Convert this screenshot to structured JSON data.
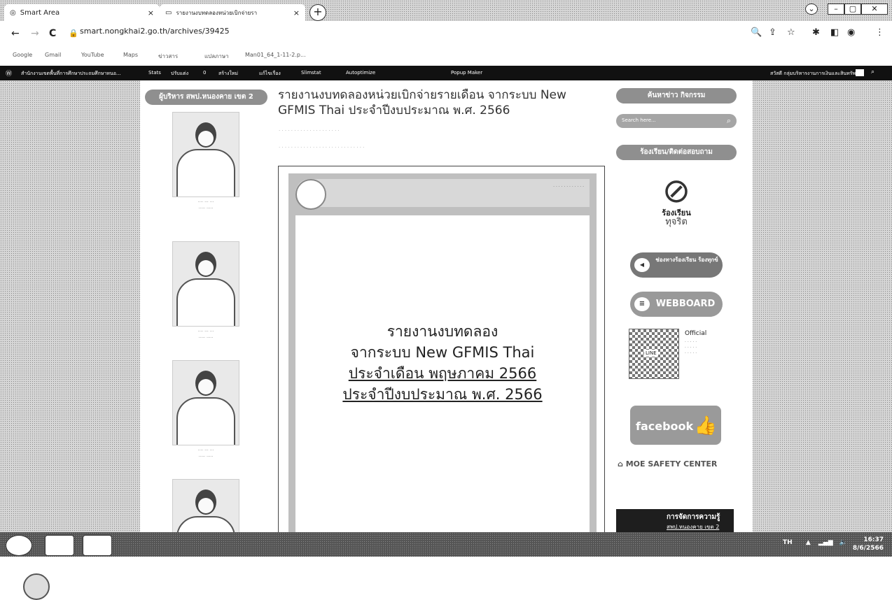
{
  "browser": {
    "tabs": [
      {
        "label": "Smart Area",
        "close": "×"
      },
      {
        "label": "รายงานงบทดลองหน่วยเบิกจ่ายรา",
        "close": "×"
      }
    ],
    "new_tab": "+",
    "url": "smart.nongkhai2.go.th/archives/39425",
    "nav": {
      "back": "←",
      "forward": "→",
      "reload": "C"
    },
    "bookmarks": [
      "Google",
      "Gmail",
      "YouTube",
      "Maps",
      "ข่าวสาร",
      "แปลภาษา",
      "Man01_64_1-11-2.p..."
    ]
  },
  "adminbar": {
    "site_name": "สำนักงานเขตพื้นที่การศึกษาประถมศึกษาหนอ...",
    "items": [
      "Stats",
      "ปรับแต่ง",
      "0",
      "สร้างใหม่",
      "แก้ไขเรื่อง",
      "Slimstat",
      "Autoptimize",
      "Popup Maker"
    ],
    "greeting": "สวัสดี กลุ่มบริหารงานการเงินและสินทรัพย์"
  },
  "left_sidebar": {
    "heading": "ผู้บริหาร สพป.หนองคาย เขต 2"
  },
  "post": {
    "title": "รายงานงบทดลองหน่วยเบิกจ่ายรายเดือน จากระบบ New GFMIS Thai ประจำปีงบประมาณ พ.ศ. 2566"
  },
  "document": {
    "line1": "รายงานงบทดลอง",
    "line2": "จากระบบ New GFMIS Thai",
    "line3": "ประจำเดือน พฤษภาคม 2566",
    "line4": "ประจำปีงบประมาณ พ.ศ. 2566"
  },
  "right_sidebar": {
    "search_heading": "ค้นหาข่าว กิจกรรม",
    "search_placeholder": "Search here...",
    "complaint_heading": "ร้องเรียน/ติดต่อสอบถาม",
    "complaint_label1": "ร้องเรียน",
    "complaint_label2": "ทุจริต",
    "channel_button": "ช่องทางร้องเรียน ร้องทุกข์",
    "webboard_button": "WEBBOARD",
    "line_official": "Official",
    "line_label": "LINE",
    "facebook": "facebook",
    "moe": "MOE SAFETY CENTER",
    "km_title": "การจัดการความรู้",
    "km_sub": "สพป.หนองคาย เขต 2"
  },
  "taskbar": {
    "lang": "TH",
    "time": "16:37",
    "date": "8/6/2566"
  }
}
